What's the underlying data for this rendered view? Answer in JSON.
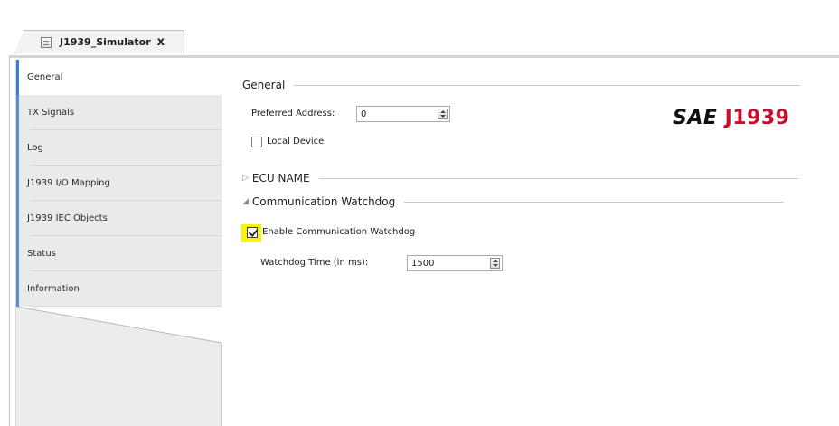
{
  "tab": {
    "title": "J1939_Simulator",
    "close_glyph": "x",
    "icon": "device-icon"
  },
  "sidebar": {
    "items": [
      {
        "label": "General",
        "active": true
      },
      {
        "label": "TX Signals",
        "active": false
      },
      {
        "label": "Log",
        "active": false
      },
      {
        "label": "J1939 I/O Mapping",
        "active": false
      },
      {
        "label": "J1939 IEC Objects",
        "active": false
      },
      {
        "label": "Status",
        "active": false
      },
      {
        "label": "Information",
        "active": false
      }
    ]
  },
  "general": {
    "header": "General",
    "preferred_address_label": "Preferred Address:",
    "preferred_address_value": "0",
    "local_device_label": "Local Device",
    "local_device_checked": false
  },
  "logo": {
    "sae": "SAE",
    "number": "J1939",
    "color_number": "#c8102e"
  },
  "ecu_name": {
    "header": "ECU NAME",
    "expanded": false
  },
  "watchdog": {
    "header": "Communication Watchdog",
    "expanded": true,
    "enable_label": "Enable Communication Watchdog",
    "enable_checked": true,
    "time_label": "Watchdog Time (in ms):",
    "time_value": "1500"
  },
  "colors": {
    "accent": "#3a7fd5",
    "highlight": "#f5f500"
  }
}
